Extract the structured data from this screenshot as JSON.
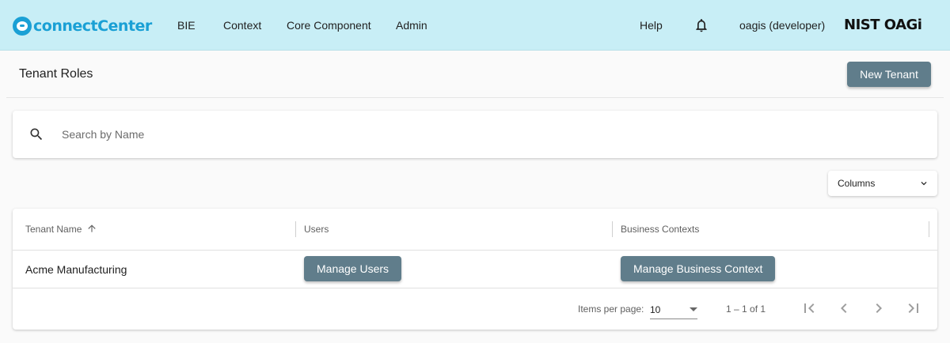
{
  "header": {
    "logo_text": "connectCenter",
    "nav": [
      "BIE",
      "Context",
      "Core Component",
      "Admin"
    ],
    "help": "Help",
    "user": "oagis (developer)",
    "org_logo": "NIST OAGi"
  },
  "page": {
    "title": "Tenant Roles",
    "new_button": "New Tenant"
  },
  "search": {
    "placeholder": "Search by Name",
    "icon": "search-icon"
  },
  "columns_select": {
    "label": "Columns"
  },
  "table": {
    "headers": [
      "Tenant Name",
      "Users",
      "Business Contexts"
    ],
    "sort": "ascending",
    "rows": [
      {
        "tenant_name": "Acme Manufacturing",
        "users_button": "Manage Users",
        "contexts_button": "Manage Business Context"
      }
    ]
  },
  "paginator": {
    "items_per_page_label": "Items per page:",
    "items_per_page": "10",
    "range": "1 – 1 of 1"
  },
  "colors": {
    "topbar": "#c8eef6",
    "brand": "#1aa0d5",
    "button": "#607d8b"
  }
}
